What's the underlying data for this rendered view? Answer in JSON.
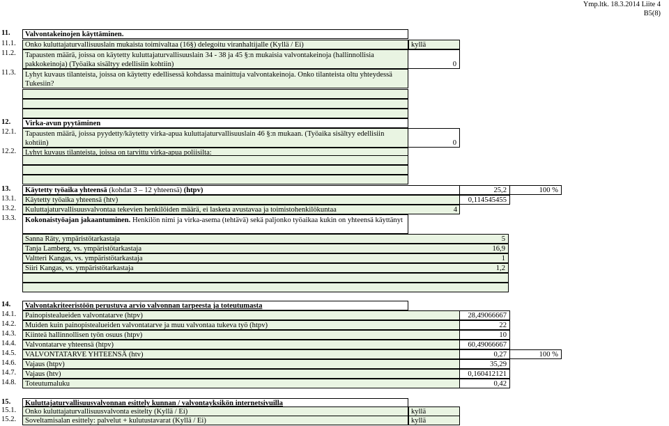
{
  "header": {
    "line1": "Ymp.ltk. 18.3.2014 Liite 4",
    "line2": "B5(8)"
  },
  "s11": {
    "num": "11.",
    "title": "Valvontakeinojen käyttäminen.",
    "r1_num": "11.1.",
    "r1_text": "Onko kuluttajaturvallisuuslain mukaista toimivaltaa (16§) delegoitu viranhaltijalle  (Kyllä / Ei)",
    "r1_val": "kyllä",
    "r2_num": "11.2.",
    "r2_text": "Tapausten määrä, joissa on käytetty kuluttajaturvallisuuslain 34 - 38 ja 45 §:n mukaisia valvontakeinoja (hallinnollisia pakkokeinoja)  (Työaika sisältyy edellisiin kohtiin)",
    "r2_val": "0",
    "r3_num": "11.3.",
    "r3_text": "Lyhyt kuvaus tilanteista, joissa on käytetty edellisessä kohdassa mainittuja valvontakeinoja. Onko tilanteista oltu yhteydessä Tukesiin?"
  },
  "s12": {
    "num": "12.",
    "title": "Virka-avun pyytäminen",
    "r1_num": "12.1.",
    "r1_text": "Tapausten määrä, joissa pyydetty/käytetty virka-apua kuluttajaturvallisuuslain 46 §:n mukaan. (Työaika sisältyy edellisiin kohtiin)",
    "r1_val": "0",
    "r2_num": "12.2.",
    "r2_text": "Lyhyt kuvaus tilanteista, joissa on tarvittu virka-apua poliisilta:"
  },
  "s13": {
    "num": "13.",
    "title_bold": "Käytetty työaika yhteensä",
    "title_rest": " (kohdat 3 – 12 yhteensä)  ",
    "title_unit": "(htpv)",
    "title_val": "25,2",
    "title_pct": "100 %",
    "r1_num": "13.1.",
    "r1_text": "Käytetty työaika yhteensä  (htv)",
    "r1_val": "0,114545455",
    "r2_num": "13.2.",
    "r2_text": "Kuluttajaturvallisuusvalvontaa tekevien henkilöiden määrä, ei lasketa avustavaa ja toimistohenkilökuntaa",
    "r2_val": "4",
    "r3_num": "13.3.",
    "r3_bold": "Kokonaistyöajan jakaantuminen.",
    "r3_text": " Henkilön nimi ja virka-asema (tehtävä) sekä paljonko työaikaa kukin on yhteensä käyttänyt",
    "persons": [
      {
        "name": "Sanna Räty, ympäristötarkastaja",
        "val": "5"
      },
      {
        "name": "Tanja Lamberg, vs. ympäristötarkastaja",
        "val": "16,9"
      },
      {
        "name": "Valtteri Kangas, vs. ympäristötarkastaja",
        "val": "1"
      },
      {
        "name": "Siiri Kangas, vs. ympäristötarkastaja",
        "val": "1,2"
      }
    ]
  },
  "s14": {
    "num": "14.",
    "title": "Valvontakriteeristöön perustuva arvio valvonnan tarpeesta ja toteutumasta",
    "rows": [
      {
        "num": "14.1.",
        "text": "Painopistealueiden valvontatarve (htpv)",
        "val": "28,49066667",
        "pct": ""
      },
      {
        "num": "14.2.",
        "text": "Muiden kuin painopistealueiden valvontatarve ja muu valvontaa tukeva työ (htpv)",
        "val": "22",
        "pct": ""
      },
      {
        "num": "14.3.",
        "text": "Kiinteä hallinnollisen työn osuus (htpv)",
        "val": "10",
        "pct": ""
      },
      {
        "num": "14.4.",
        "text": "Valvontatarve yhteensä   (htpv)",
        "val": "60,49066667",
        "pct": ""
      },
      {
        "num": "14.5.",
        "text": "VALVONTATARVE YHTEENSÄ   (htv)",
        "val": "0,27",
        "pct": "100 %"
      },
      {
        "num": "14.6.",
        "text": "Vajaus (htpv)",
        "val": "35,29",
        "pct": ""
      },
      {
        "num": "14.7.",
        "text": "Vajaus (htv)",
        "val": "0,160412121",
        "pct": ""
      },
      {
        "num": "14.8.",
        "text": "Toteutumaluku",
        "val": "0,42",
        "pct": ""
      }
    ]
  },
  "s15": {
    "num": "15.",
    "title": "Kuluttajaturvallisuusvalvonnan esittely kunnan / valvontayksikön internetsivuilla",
    "r1_num": "15.1.",
    "r1_text": "Onko kuluttajaturvallisuusvalvonta esitelty  (Kyllä / Ei)",
    "r1_val": "kyllä",
    "r2_num": "15.2.",
    "r2_text": "Soveltamisalan esittely: palvelut + kulutustavarat  (Kyllä / Ei)",
    "r2_val": "kyllä"
  }
}
